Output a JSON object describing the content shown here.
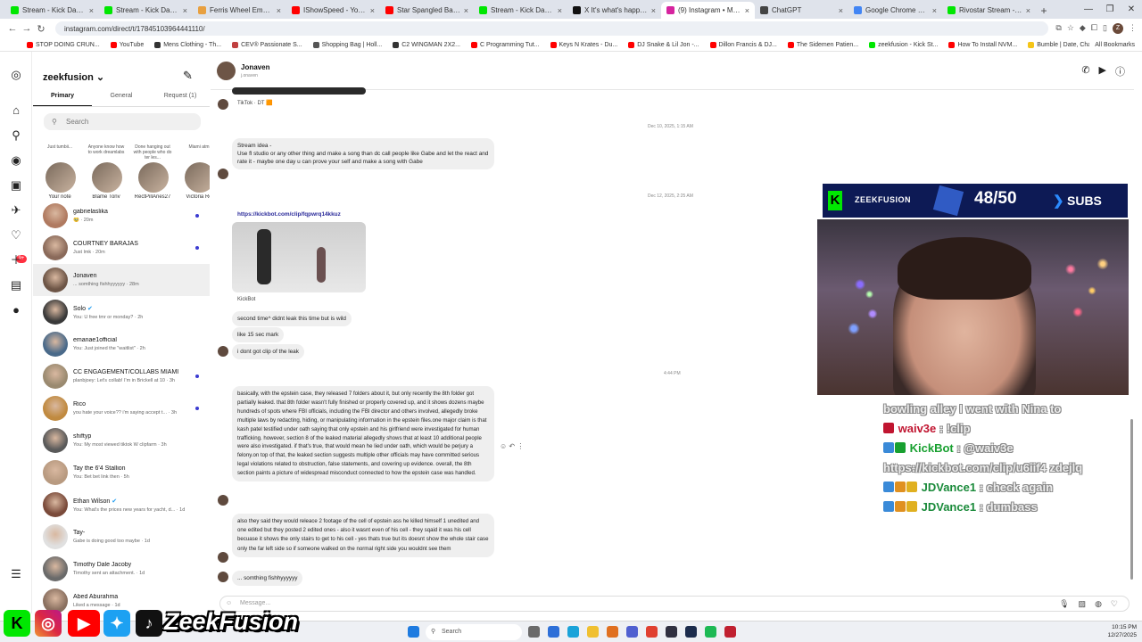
{
  "browser": {
    "tabs": [
      {
        "title": "Stream - Kick Dashboard",
        "color": "#00e701",
        "active": false
      },
      {
        "title": "Stream - Kick Dashboard",
        "color": "#00e701",
        "active": false
      },
      {
        "title": "Ferris Wheel Emoji | M",
        "color": "#e8a040",
        "active": false
      },
      {
        "title": "IShowSpeed - YouTube",
        "color": "#ff0000",
        "active": false
      },
      {
        "title": "Star Spangled Banner wit",
        "color": "#ff0000",
        "active": false
      },
      {
        "title": "Stream - Kick Dashbo",
        "color": "#00e701",
        "active": false
      },
      {
        "title": "X It's what's happening /",
        "color": "#111111",
        "active": false
      },
      {
        "title": "(9) Instagram • Messages",
        "color": "#d6249f",
        "active": true
      },
      {
        "title": "ChatGPT",
        "color": "#444444",
        "active": false
      },
      {
        "title": "Google Chrome Help",
        "color": "#4285f4",
        "active": false
      },
      {
        "title": "Rivostar Stream - Watch Li",
        "color": "#00e701",
        "active": false
      }
    ],
    "url": "instagram.com/direct/t/17845103964441110/",
    "bookmarks": [
      {
        "label": "STOP DOING CRUN...",
        "color": "#ff0000"
      },
      {
        "label": "YouTube",
        "color": "#ff0000"
      },
      {
        "label": "Mens Clothing - Th...",
        "color": "#333333"
      },
      {
        "label": "CEV® Passionate S...",
        "color": "#c04040"
      },
      {
        "label": "Shopping Bag | Holl...",
        "color": "#555555"
      },
      {
        "label": "C2 WINGMAN 2X2...",
        "color": "#333333"
      },
      {
        "label": "C Programming Tut...",
        "color": "#ff0000"
      },
      {
        "label": "Keys N Krates - Du...",
        "color": "#ff0000"
      },
      {
        "label": "DJ Snake & Lil Jon -...",
        "color": "#ff0000"
      },
      {
        "label": "Dillon Francis & DJ...",
        "color": "#ff0000"
      },
      {
        "label": "The Sidemen Patien...",
        "color": "#ff0000"
      },
      {
        "label": "zeekfusion - Kick St...",
        "color": "#00e701"
      },
      {
        "label": "How To Install NVM...",
        "color": "#ff0000"
      },
      {
        "label": "Bumble | Date, Chat...",
        "color": "#f5c518"
      },
      {
        "label": "cases",
        "color": "#9040c0"
      }
    ],
    "all_bookmarks": "All Bookmarks",
    "profile_initial": "Z"
  },
  "rail_icons": [
    "instagram-icon",
    "home-icon",
    "search-icon",
    "explore-icon",
    "reels-icon",
    "messages-icon",
    "notifications-icon",
    "create-icon",
    "dashboard-icon",
    "profile-icon"
  ],
  "sidebar": {
    "username": "zeekfusion",
    "tabs": [
      "Primary",
      "General",
      "Request (1)"
    ],
    "search_placeholder": "Search",
    "notes": [
      {
        "bubble": "Just tumbii...",
        "name": "Your note"
      },
      {
        "bubble": "Anyone know how to work dreamlabs",
        "name": "Blame Tony"
      },
      {
        "bubble": "Done hanging out with people who do ter les...",
        "name": "RectPillAries27"
      },
      {
        "bubble": "Miami atm",
        "name": "Victoria Ro"
      }
    ],
    "conversations": [
      {
        "name": "gabrielaslika",
        "preview": "🥹 · 20m",
        "unread": true,
        "verified": false
      },
      {
        "name": "COURTNEY BARAJAS",
        "preview": "Just lmk · 20m",
        "unread": true,
        "verified": false
      },
      {
        "name": "Jonaven",
        "preview": "... somthing fishhyyyyyy · 28m",
        "unread": false,
        "verified": false,
        "selected": true
      },
      {
        "name": "Solo",
        "preview": "You: U free tmr or monday? · 2h",
        "unread": false,
        "verified": true
      },
      {
        "name": "emanae1official",
        "preview": "You: Just joined the \"waitlist\" · 2h",
        "unread": false,
        "verified": false
      },
      {
        "name": "CC ENGAGEMENT/COLLABS MIAMI",
        "preview": "planbjoey: Let's collab! I'm in Brickell at 10 · 3h",
        "unread": true,
        "verified": false
      },
      {
        "name": "Rico",
        "preview": "you hate your voice?? i'm saying accept t... · 3h",
        "unread": true,
        "verified": false
      },
      {
        "name": "shiftyp",
        "preview": "You: My most viewed tiktok W clipfarm · 3h",
        "unread": false,
        "verified": false
      },
      {
        "name": "Tay the 6'4 Stallion",
        "preview": "You: Bet bet link then · 5h",
        "unread": false,
        "verified": false
      },
      {
        "name": "Ethan Wilson",
        "preview": "You: What's the prices new years for yacht, d... · 1d",
        "unread": false,
        "verified": true
      },
      {
        "name": "Tay-",
        "preview": "Gabe is doing good too maybe · 1d",
        "unread": false,
        "verified": false
      },
      {
        "name": "Timothy Dale Jacoby",
        "preview": "Timothy sent an attachment. · 1d",
        "unread": false,
        "verified": false
      },
      {
        "name": "Abed Aburahma",
        "preview": "Liked a message · 1d",
        "unread": false,
        "verified": false
      }
    ]
  },
  "chat": {
    "name": "Jonaven",
    "username": "j.onaven",
    "attribution_tiktok": "TikTok · DT 🟧",
    "ts1": "Dec 10, 2025, 1:15 AM",
    "msg_stream_idea": "Stream idea -\nUse fl studio or any other thing and make a song than dc call people like Gabe and let the react and rate it - maybe one day u can prove your self and make a song with Gabe",
    "ts2": "Dec 12, 2025, 2:25 AM",
    "link": "https://kickbot.com/clip/fqpwrq14kkuz",
    "attribution_kickbot": "KickBot",
    "msg_second": "second time^ didnt leak this time but is wild",
    "msg_15sec": "like 15 sec mark",
    "msg_noclip": "i dont got clip of the leak",
    "ts3": "4:44 PM",
    "msg_epstein": "basically, with the epstein case, they released 7 folders about it, but only recently the 8th folder got partially leaked. that 8th folder wasn't fully finished or properly covered up, and it shows dozens maybe hundreds of spots where FBI officials, including the FBI director and others involved, allegedly broke multiple laws by redacting, hiding, or manipulating information in the epstein files.one major claim is that kash patel testified under oath saying that only epstein and his girlfriend were investigated for human trafficking. however, section 8 of the leaked material allegedly shows that at least 10 additional people were also investigated. if that's true, that would mean he lied under oath, which would be perjury a felony.on top of that, the leaked section suggests multiple other officials may have committed serious legal violations related to obstruction, false statements, and covering up evidence. overall, the 8th section paints a picture of widespread misconduct connected to how the epstein case was handled.",
    "msg_footage": "also they said they would releace 2 footage of the cell of epstein ass he killed himself 1 unedited and one edited but they posted 2 edited ones - also it wasnt even of his cell - they sqaid it was his cell becuase it shows the only stairs to get to his cell - yes thats true but its doesnt show the whole stair case only the far left side so if someone walked on the normal right side you wouldnt see them",
    "msg_last": "... somthing fishhyyyyyy",
    "composer_placeholder": "Message..."
  },
  "overlay": {
    "brand": "ZEEKFUSION",
    "sub_count": "48/50",
    "subs_label": "SUBS",
    "accent": "#00e701",
    "chat_lines": [
      {
        "user": "",
        "text": "bowling alley I went with Nina to"
      },
      {
        "user": "waiv3e",
        "text": " : !clip"
      },
      {
        "user": "KickBot",
        "text": " : @waiv3e https://kickbot.com/clip/u6iif4 zdejlq"
      },
      {
        "user": "JDVance1",
        "text": " : check again"
      },
      {
        "user": "JDVance1",
        "text": " : dumbass"
      }
    ],
    "socials": "ZeekFusion"
  },
  "taskbar": {
    "search": "Search",
    "time": "10:15 PM",
    "date": "12/27/2025"
  }
}
